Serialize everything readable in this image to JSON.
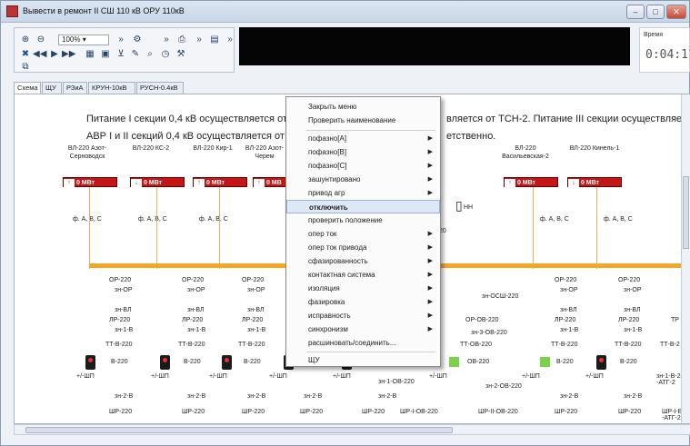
{
  "window": {
    "title": "Вывести в ремонт  II СШ 110 кВ ОРУ 110кВ",
    "buttons": [
      "–",
      "□",
      "✕"
    ]
  },
  "toolbar": {
    "zoom": "100%"
  },
  "time": {
    "label": "Время",
    "value": "0:04:11"
  },
  "tabs": [
    "Схема",
    "ЩУ",
    "РЗиА",
    "КРУН-10кВ",
    "РУСН-0.4кВ"
  ],
  "notes": {
    "line1_left": "Питание I секции 0,4 кВ осуществляется от ТСН",
    "line1_right": "вляется от ТСН-2. Питание III секции осуществляется от Т",
    "line2_left": "АВР I и II секций 0,4 кВ осуществляется от III сек",
    "line2_right": "етственно."
  },
  "feeders_left": [
    {
      "name": "ВЛ-220 Азот-Серноводск",
      "mw": "0 МВт",
      "dir": "↑"
    },
    {
      "name": "ВЛ-220 КС-2",
      "mw": "0 МВт",
      "dir": "↓"
    },
    {
      "name": "ВЛ-220 Кир-1",
      "mw": "0 МВт",
      "dir": "↑"
    },
    {
      "name": "ВЛ-220 Азот-Черем",
      "mw": "0 МВ",
      "dir": "↑"
    }
  ],
  "feeders_right": [
    {
      "name": "ВЛ-220 Васильевская-2",
      "mw": "0 МВт",
      "dir": "↑"
    },
    {
      "name": "ВЛ-220 Кинель-1",
      "mw": "0 МВт",
      "dir": "↓"
    }
  ],
  "phase_label": "ф. А, В, С",
  "nn_label": "НН",
  "value_20": "20",
  "bays_left": [
    {
      "op": "ОР-220",
      "zn_op": "зн-ОР",
      "zn_vl": "зн-ВЛ",
      "lr": "ЛР-220",
      "zn1v": "зн-1-В",
      "tt": "ТТ-В-220",
      "v": "В-220",
      "zn2v": "зн-2-В",
      "shr": "ШР-220",
      "ushp": "+/-ШП"
    },
    {
      "op": "ОР-220",
      "zn_op": "зн-ОР",
      "zn_vl": "зн-ВЛ",
      "lr": "ЛР-220",
      "zn1v": "зн-1-В",
      "tt": "ТТ-В-220",
      "v": "В-220",
      "zn2v": "зн-2-В",
      "shr": "ШР-220",
      "ushp": "+/-ШП"
    },
    {
      "op": "ОР-220",
      "zn_op": "зн-ОР",
      "zn_vl": "зн-ВЛ",
      "lr": "ЛР-220",
      "zn1v": "зн-1-В",
      "tt": "ТТ-В-220",
      "v": "В-220",
      "zn2v": "зн-2-В",
      "shr": "ШР-220",
      "ushp": "+/-ШП"
    }
  ],
  "bays_right": [
    {
      "op": "ОР-220",
      "zn_op": "зн-ОР",
      "zn_vl": "зн-ВЛ",
      "lr": "ЛР-220",
      "zn1v": "зн-1-В",
      "tt": "ТТ-В-220",
      "v": "В-220",
      "zn2v": "зн-2-В",
      "shr": "ШР-220",
      "ushp": "+/-ШП"
    },
    {
      "op": "ОР-220",
      "zn_op": "зн-ОР",
      "zn_vl": "зн-ВЛ",
      "lr": "ЛР-220",
      "zn1v": "зн-1-В",
      "tt": "ТТ-В-220",
      "v": "В-220",
      "zn2v": "зн-2-В",
      "shr": "ШР-220",
      "ushp": "+/-ШП"
    }
  ],
  "middle": {
    "ushp": "+/-ШП",
    "shr": "ШР-220",
    "zn2v": "зн-2-В",
    "zn1ov": "зн-1-ОВ-220",
    "shr_iob": "ШР-I-ОВ-220",
    "zn_osh": "зн-ОСШ-220",
    "op_ov": "ОР-ОВ-220",
    "zn3ov": "зн-3-ОВ-220",
    "tt_ov": "ТТ-ОВ-220",
    "ov": "ОВ-220",
    "zn2ov": "зн-2-ОВ-220",
    "ushp2": "+/-ШП",
    "shr_iiob": "ШР-II-ОВ-220"
  },
  "far_right": {
    "tr": "ТР",
    "tt": "ТТ-В-2",
    "zn1v": "зн-1-В-220 -АТГ-2",
    "shr": "ШР-I-В -АТГ-2"
  },
  "context_menu": [
    {
      "label": "Закрыть меню",
      "sub": false
    },
    {
      "label": "Проверить наименование",
      "sub": false
    },
    {
      "label": "пофазно[А]",
      "sub": true
    },
    {
      "label": "пофазно[В]",
      "sub": true
    },
    {
      "label": "пофазно[С]",
      "sub": true
    },
    {
      "label": "зашунтировано",
      "sub": true
    },
    {
      "label": "привод агр",
      "sub": true
    },
    {
      "label": "отключить",
      "sub": false,
      "highlighted": true
    },
    {
      "label": "проверить положение",
      "sub": false
    },
    {
      "label": "опер ток",
      "sub": true
    },
    {
      "label": "опер ток привода",
      "sub": true
    },
    {
      "label": "сфазированность",
      "sub": true
    },
    {
      "label": "контактная система",
      "sub": true
    },
    {
      "label": "изоляция",
      "sub": true
    },
    {
      "label": "фазировка",
      "sub": true
    },
    {
      "label": "исправность",
      "sub": true
    },
    {
      "label": "синхронизм",
      "sub": true
    },
    {
      "label": "расшиновать/соединить...",
      "sub": false
    },
    {
      "label": "ЩУ",
      "sub": false
    }
  ],
  "colors": {
    "accent": "#f5a623",
    "red": "#c41616",
    "highlight": "#dde8f7"
  }
}
